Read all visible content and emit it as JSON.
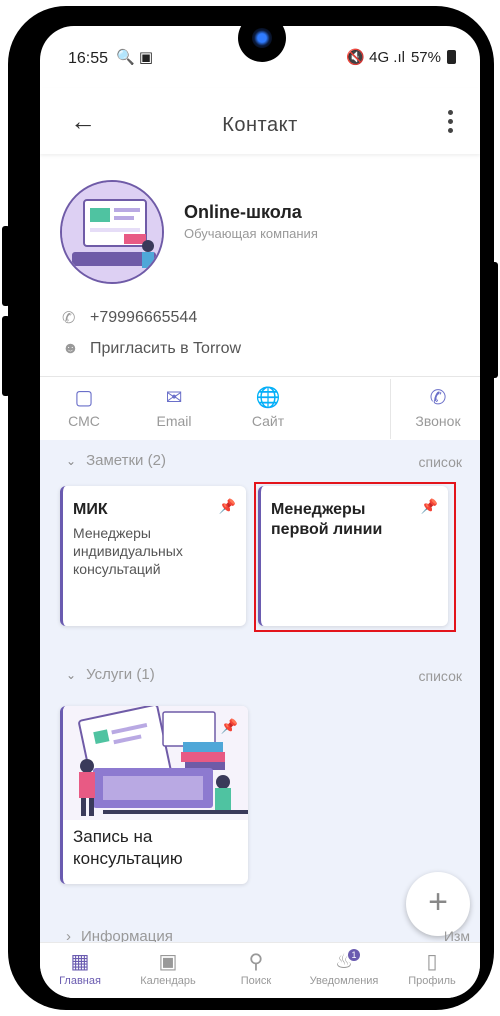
{
  "status_bar": {
    "time": "16:55",
    "left_icons": "🔍 ▣",
    "signal": "🔇 4G .ıl",
    "battery": "57%"
  },
  "app_bar": {
    "title": "Контакт"
  },
  "profile": {
    "name": "Online-школа",
    "subtitle": "Обучающая компания"
  },
  "contacts": {
    "phone": "+79996665544",
    "invite": "Пригласить в Torrow"
  },
  "actions": [
    {
      "label": "СМС",
      "icon": "chat-icon"
    },
    {
      "label": "Email",
      "icon": "mail-icon"
    },
    {
      "label": "Сайт",
      "icon": "globe-icon"
    },
    {
      "label": "Звонок",
      "icon": "phone-icon"
    }
  ],
  "notes": {
    "header": "Заметки (2)",
    "list_label": "список",
    "items": [
      {
        "title": "МИК",
        "body_line1": "Менеджеры",
        "body_line2": "индивидуальных",
        "body_line3": "консультаций"
      },
      {
        "title_line1": "Менеджеры",
        "title_line2": "первой линии"
      }
    ]
  },
  "services": {
    "header": "Услуги (1)",
    "list_label": "список",
    "items": [
      {
        "title_line1": "Запись на",
        "title_line2": "консультацию"
      }
    ]
  },
  "info": {
    "header": "Информация",
    "right_label": "Изм"
  },
  "fab": {
    "label": "+"
  },
  "bottom_nav": [
    {
      "label": "Главная",
      "icon": "grid-icon",
      "active": true
    },
    {
      "label": "Календарь",
      "icon": "calendar-icon"
    },
    {
      "label": "Поиск",
      "icon": "search-icon"
    },
    {
      "label": "Уведомления",
      "icon": "bell-icon",
      "badge": "1"
    },
    {
      "label": "Профиль",
      "icon": "profile-icon"
    }
  ]
}
